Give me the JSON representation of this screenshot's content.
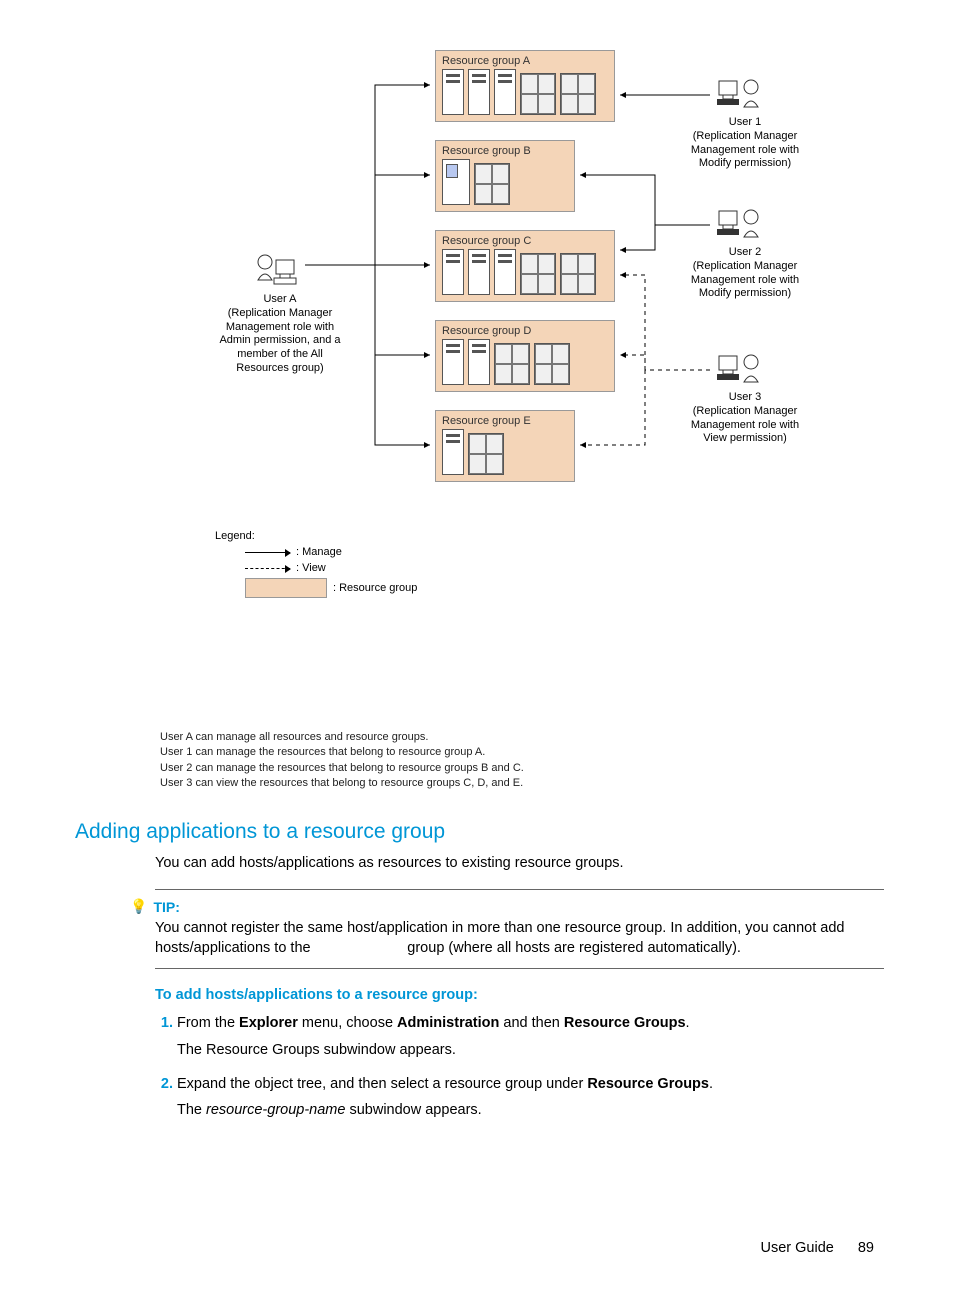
{
  "diagram": {
    "groups": {
      "a": "Resource group A",
      "b": "Resource group B",
      "c": "Resource group C",
      "d": "Resource group D",
      "e": "Resource group E"
    },
    "users": {
      "a": {
        "name": "User A",
        "desc": "(Replication Manager\nManagement role with\nAdmin permission, and a\nmember of the All\nResources group)"
      },
      "u1": {
        "name": "User 1",
        "desc": "(Replication Manager\nManagement role with\nModify permission)"
      },
      "u2": {
        "name": "User 2",
        "desc": "(Replication Manager\nManagement role with\nModify permission)"
      },
      "u3": {
        "name": "User 3",
        "desc": "(Replication Manager\nManagement role with\nView permission)"
      }
    },
    "legend": {
      "title": "Legend:",
      "manage": ": Manage",
      "view": ": View",
      "rg": ": Resource group"
    },
    "notes": [
      "User A can manage all resources and resource groups.",
      "User 1 can manage the resources that belong to resource group A.",
      "User 2 can manage the resources that belong to resource groups B and C.",
      "User 3 can view the resources that belong to resource groups C, D, and E."
    ]
  },
  "section": {
    "title": "Adding applications to a resource group",
    "intro": "You can add hosts/applications as resources to existing resource groups."
  },
  "tip": {
    "label": "TIP:",
    "text_a": "You cannot register the same host/application in more than one resource group. In addition, you cannot add hosts/applications to the ",
    "text_b": " group (where all hosts are registered automatically)."
  },
  "subhead": "To add hosts/applications to a resource group:",
  "steps": {
    "s1a": "From the ",
    "s1b": "Explorer",
    "s1c": " menu, choose ",
    "s1d": "Administration",
    "s1e": " and then ",
    "s1f": "Resource Groups",
    "s1g": ".",
    "s1sub": "The Resource Groups subwindow appears.",
    "s2a": "Expand the object tree, and then select a resource group under ",
    "s2b": "Resource Groups",
    "s2c": ".",
    "s2sub_a": "The ",
    "s2sub_b": "resource-group-name",
    "s2sub_c": " subwindow appears."
  },
  "footer": {
    "title": "User Guide",
    "page": "89"
  }
}
